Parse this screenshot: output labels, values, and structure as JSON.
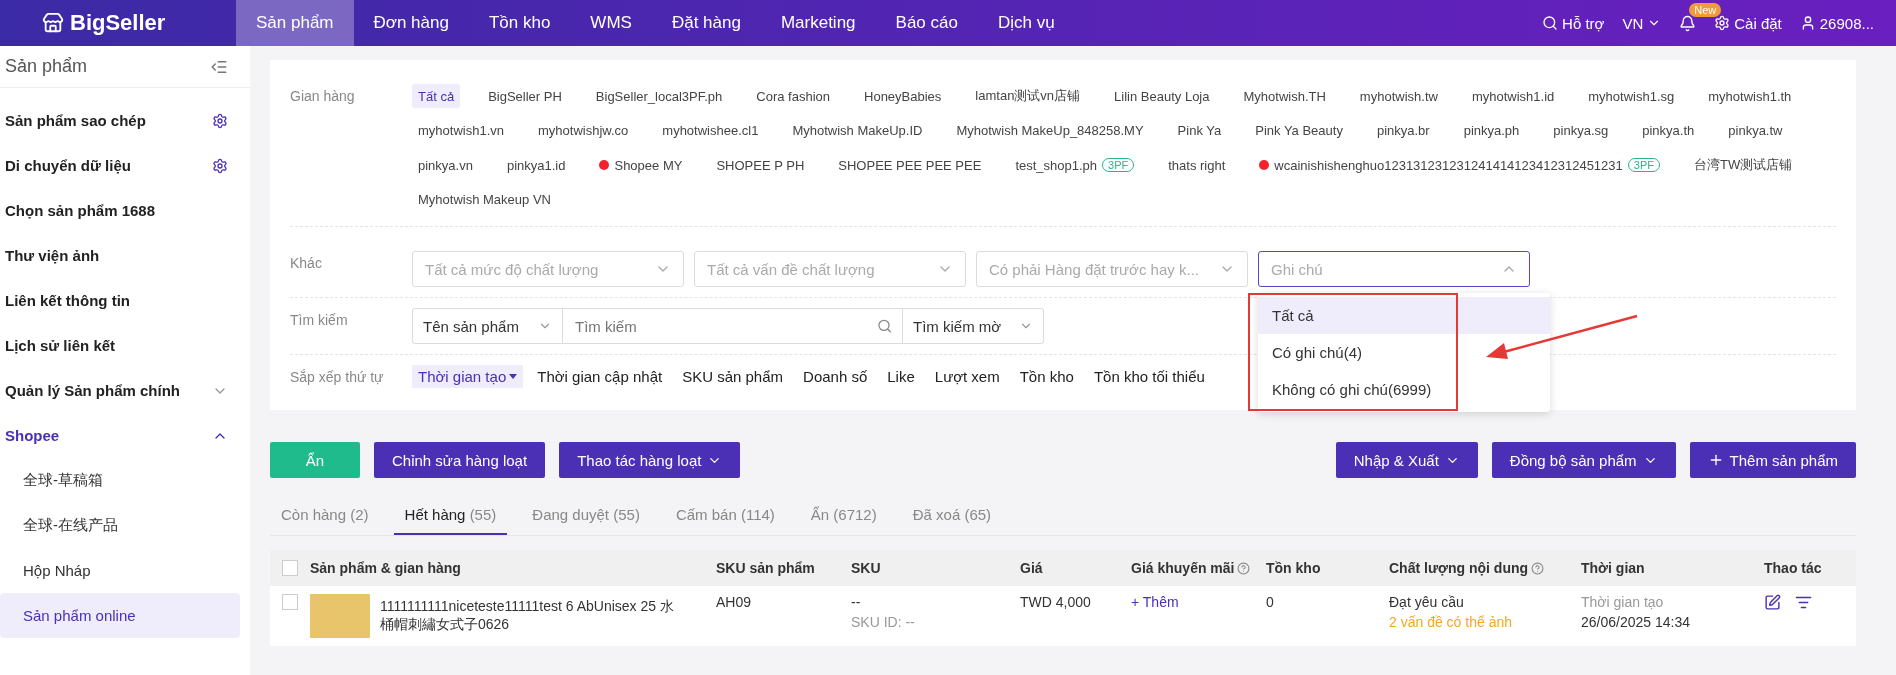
{
  "nav": {
    "logo": "BigSeller",
    "items": [
      {
        "label": "Sản phẩm",
        "selected": true
      },
      {
        "label": "Đơn hàng",
        "selected": false
      },
      {
        "label": "Tồn kho",
        "selected": false
      },
      {
        "label": "WMS",
        "selected": false
      },
      {
        "label": "Đặt hàng",
        "selected": false
      },
      {
        "label": "Marketing",
        "selected": false
      },
      {
        "label": "Báo cáo",
        "selected": false
      },
      {
        "label": "Dịch vụ",
        "selected": false
      }
    ],
    "help": "Hỗ trợ",
    "language": "VN",
    "badge": "New",
    "settings": "Cài đặt",
    "user": "26908..."
  },
  "sidebar": {
    "title": "Sản phẩm",
    "items": [
      {
        "label": "Sản phẩm sao chép",
        "kind": "gear"
      },
      {
        "label": "Di chuyển dữ liệu",
        "kind": "gear"
      },
      {
        "label": "Chọn sản phẩm 1688",
        "kind": "plain"
      },
      {
        "label": "Thư viện ảnh",
        "kind": "plain"
      },
      {
        "label": "Liên kết thông tin",
        "kind": "plain"
      },
      {
        "label": "Lịch sử liên kết",
        "kind": "plain"
      },
      {
        "label": "Quản lý Sản phẩm chính",
        "kind": "group",
        "expanded": false
      },
      {
        "label": "Shopee",
        "kind": "group",
        "expanded": true,
        "children": [
          {
            "label": "全球-草稿箱",
            "selected": false
          },
          {
            "label": "全球-在线产品",
            "selected": false
          },
          {
            "label": "Hộp Nháp",
            "selected": false
          },
          {
            "label": "Sản phẩm online",
            "selected": true
          }
        ]
      }
    ]
  },
  "filters": {
    "shops": {
      "label": "Gian hàng",
      "items": [
        {
          "label": "Tất cả",
          "selected": true
        },
        {
          "label": "BigSeller PH",
          "selected": false
        },
        {
          "label": "BigSeller_local3PF.ph",
          "selected": false
        },
        {
          "label": "Cora fashion",
          "selected": false
        },
        {
          "label": "HoneyBabies",
          "selected": false
        },
        {
          "label": "lamtan测试vn店铺",
          "selected": false
        },
        {
          "label": "Lilin Beauty Loja",
          "selected": false
        },
        {
          "label": "Myhotwish.TH",
          "selected": false
        },
        {
          "label": "myhotwish.tw",
          "selected": false
        },
        {
          "label": "myhotwish1.id",
          "selected": false
        },
        {
          "label": "myhotwish1.sg",
          "selected": false
        },
        {
          "label": "myhotwish1.th",
          "selected": false
        },
        {
          "label": "myhotwish1.vn",
          "selected": false
        },
        {
          "label": "myhotwishjw.co",
          "selected": false
        },
        {
          "label": "myhotwishee.cl1",
          "selected": false
        },
        {
          "label": "Myhotwish MakeUp.ID",
          "selected": false
        },
        {
          "label": "Myhotwish MakeUp_848258.MY",
          "selected": false
        },
        {
          "label": "Pink Ya",
          "selected": false
        },
        {
          "label": "Pink Ya Beauty",
          "selected": false
        },
        {
          "label": "pinkya.br",
          "selected": false
        },
        {
          "label": "pinkya.ph",
          "selected": false
        },
        {
          "label": "pinkya.sg",
          "selected": false
        },
        {
          "label": "pinkya.th",
          "selected": false
        },
        {
          "label": "pinkya.tw",
          "selected": false
        },
        {
          "label": "pinkya.vn",
          "selected": false
        },
        {
          "label": "pinkya1.id",
          "selected": false
        },
        {
          "label": "Shopee MY",
          "selected": false,
          "color": "#f5222d"
        },
        {
          "label": "SHOPEE P PH",
          "selected": false
        },
        {
          "label": "SHOPEE PEE PEE PEE",
          "selected": false
        },
        {
          "label": "test_shop1.ph",
          "selected": false,
          "tag": "3PF"
        },
        {
          "label": "thats right",
          "selected": false
        },
        {
          "label": "wcainishishenghuo123131231231241414123412312451231",
          "selected": false,
          "color": "#f5222d",
          "tag": "3PF"
        },
        {
          "label": "台湾TW测试店铺",
          "selected": false
        },
        {
          "label": "Myhotwish Makeup VN",
          "selected": false
        }
      ]
    },
    "other": {
      "label": "Khác",
      "selects": [
        {
          "placeholder": "Tất cả mức độ chất lượng",
          "focused": false
        },
        {
          "placeholder": "Tất cả vấn đề chất lượng",
          "focused": false
        },
        {
          "placeholder": "Có phải Hàng đặt trước hay k...",
          "focused": false
        },
        {
          "placeholder": "Ghi chú",
          "focused": true
        }
      ],
      "options": [
        {
          "label": "Tất cả",
          "selected": true
        },
        {
          "label": "Có ghi chú(4)",
          "selected": false
        },
        {
          "label": "Không có ghi chú(6999)",
          "selected": false
        }
      ]
    },
    "search": {
      "label": "Tìm kiếm",
      "field_type": "Tên sản phẩm",
      "placeholder": "Tìm kiếm",
      "mode": "Tìm kiếm mờ"
    },
    "sort": {
      "label": "Sắp xếp thứ tự",
      "items": [
        {
          "label": "Thời gian tạo",
          "selected": true
        },
        {
          "label": "Thời gian cập nhật",
          "selected": false
        },
        {
          "label": "SKU sản phẩm",
          "selected": false
        },
        {
          "label": "Doanh số",
          "selected": false
        },
        {
          "label": "Like",
          "selected": false
        },
        {
          "label": "Lượt xem",
          "selected": false
        },
        {
          "label": "Tồn kho",
          "selected": false
        },
        {
          "label": "Tồn kho tối thiểu",
          "selected": false
        }
      ]
    }
  },
  "actions_left": [
    {
      "label": "Ẩn",
      "kind": "green"
    },
    {
      "label": "Chỉnh sửa hàng loạt",
      "kind": "plain"
    },
    {
      "label": "Thao tác hàng loạt",
      "kind": "menu"
    }
  ],
  "actions_right": [
    {
      "label": "Nhập & Xuất",
      "kind": "menu"
    },
    {
      "label": "Đồng bộ sản phẩm",
      "kind": "menu"
    },
    {
      "label": "Thêm sản phẩm",
      "kind": "add"
    }
  ],
  "tabs": [
    {
      "label": "Còn hàng (2)",
      "selected": false
    },
    {
      "label": "Hết hàng",
      "count": "(55)",
      "selected": true
    },
    {
      "label": "Đang duyệt (55)",
      "selected": false
    },
    {
      "label": "Cấm bán (114)",
      "selected": false
    },
    {
      "label": "Ẩn (6712)",
      "selected": false
    },
    {
      "label": "Đã xoá (65)",
      "selected": false
    }
  ],
  "table": {
    "all_checked": false,
    "columns": [
      {
        "label": "Sản phẩm & gian hàng",
        "help": false
      },
      {
        "label": "SKU sản phẩm",
        "help": false
      },
      {
        "label": "SKU",
        "help": false
      },
      {
        "label": "Giá",
        "help": false
      },
      {
        "label": "Giá khuyến mãi",
        "help": true
      },
      {
        "label": "Tồn kho",
        "help": false
      },
      {
        "label": "Chất lượng nội dung",
        "help": true
      },
      {
        "label": "Thời gian",
        "help": false
      },
      {
        "label": "Thao tác",
        "help": false
      }
    ],
    "rows": [
      {
        "checked": false,
        "name": "1111111111niceteste11111test 6 AbUnisex 25 水桶帽刺繡女式子0626",
        "product_sku": "AH09",
        "sku": "--",
        "sku_id": "SKU ID: --",
        "price": "TWD 4,000",
        "promo": "+ Thêm",
        "stock": "0",
        "quality": "Đạt yêu cầu",
        "quality_issue": "2 vấn đề có thể ảnh",
        "time_label": "Thời gian tạo",
        "time": "26/06/2025 14:34"
      }
    ]
  }
}
